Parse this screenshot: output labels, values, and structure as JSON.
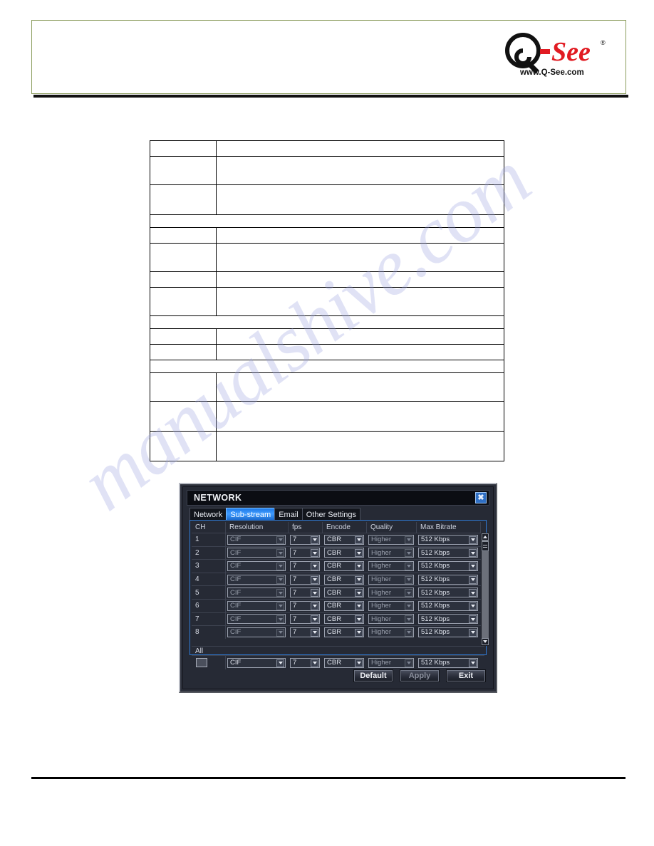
{
  "page": {
    "watermark_text": "manualshive.com",
    "banner": {
      "logo_brand": "Q-See",
      "logo_url_text": "www.Q-See.com",
      "logo_trademark": "®",
      "brand_color": "#e11b22",
      "banner_green": "#9cc455"
    },
    "spec_table": {
      "rows": [
        {
          "label": "",
          "value": ""
        },
        {
          "label": "",
          "value": ""
        },
        {
          "label": "",
          "value": ""
        },
        {
          "label": "",
          "value": "",
          "span": true
        },
        {
          "label": "",
          "value": ""
        },
        {
          "label": "",
          "value": ""
        },
        {
          "label": "",
          "value": ""
        },
        {
          "label": "",
          "value": ""
        },
        {
          "label": "",
          "value": "",
          "span": true
        },
        {
          "label": "",
          "value": ""
        },
        {
          "label": "",
          "value": ""
        },
        {
          "label": "",
          "value": "",
          "span": true
        },
        {
          "label": "",
          "value": ""
        },
        {
          "label": "",
          "value": ""
        },
        {
          "label": "",
          "value": ""
        }
      ]
    }
  },
  "dialog": {
    "title": "NETWORK",
    "close_label": "☒",
    "close_icon": "close-icon",
    "tabs": [
      {
        "label": "Network",
        "active": false
      },
      {
        "label": "Sub-stream",
        "active": true
      },
      {
        "label": "Email",
        "active": false
      },
      {
        "label": "Other Settings",
        "active": false
      }
    ],
    "accent_color": "#2f7ad6",
    "grid": {
      "columns": [
        "CH",
        "Resolution",
        "fps",
        "Encode",
        "Quality",
        "Max  Bitrate"
      ],
      "rows": [
        {
          "ch": "1",
          "resolution": "CIF",
          "fps": "7",
          "encode": "CBR",
          "quality": "Higher",
          "bitrate": "512 Kbps"
        },
        {
          "ch": "2",
          "resolution": "CIF",
          "fps": "7",
          "encode": "CBR",
          "quality": "Higher",
          "bitrate": "512 Kbps"
        },
        {
          "ch": "3",
          "resolution": "CIF",
          "fps": "7",
          "encode": "CBR",
          "quality": "Higher",
          "bitrate": "512 Kbps"
        },
        {
          "ch": "4",
          "resolution": "CIF",
          "fps": "7",
          "encode": "CBR",
          "quality": "Higher",
          "bitrate": "512 Kbps"
        },
        {
          "ch": "5",
          "resolution": "CIF",
          "fps": "7",
          "encode": "CBR",
          "quality": "Higher",
          "bitrate": "512 Kbps"
        },
        {
          "ch": "6",
          "resolution": "CIF",
          "fps": "7",
          "encode": "CBR",
          "quality": "Higher",
          "bitrate": "512 Kbps"
        },
        {
          "ch": "7",
          "resolution": "CIF",
          "fps": "7",
          "encode": "CBR",
          "quality": "Higher",
          "bitrate": "512 Kbps"
        },
        {
          "ch": "8",
          "resolution": "CIF",
          "fps": "7",
          "encode": "CBR",
          "quality": "Higher",
          "bitrate": "512 Kbps"
        }
      ],
      "all_label": "All",
      "all_row": {
        "checked": false,
        "resolution": "CIF",
        "fps": "7",
        "encode": "CBR",
        "quality": "Higher",
        "bitrate": "512 Kbps"
      },
      "scrollbar": {
        "up_icon": "chevron-up-icon",
        "down_icon": "chevron-down-icon",
        "thumb_position": "top"
      }
    },
    "buttons": [
      {
        "label": "Default",
        "disabled": false
      },
      {
        "label": "Apply",
        "disabled": true
      },
      {
        "label": "Exit",
        "disabled": false
      }
    ]
  }
}
